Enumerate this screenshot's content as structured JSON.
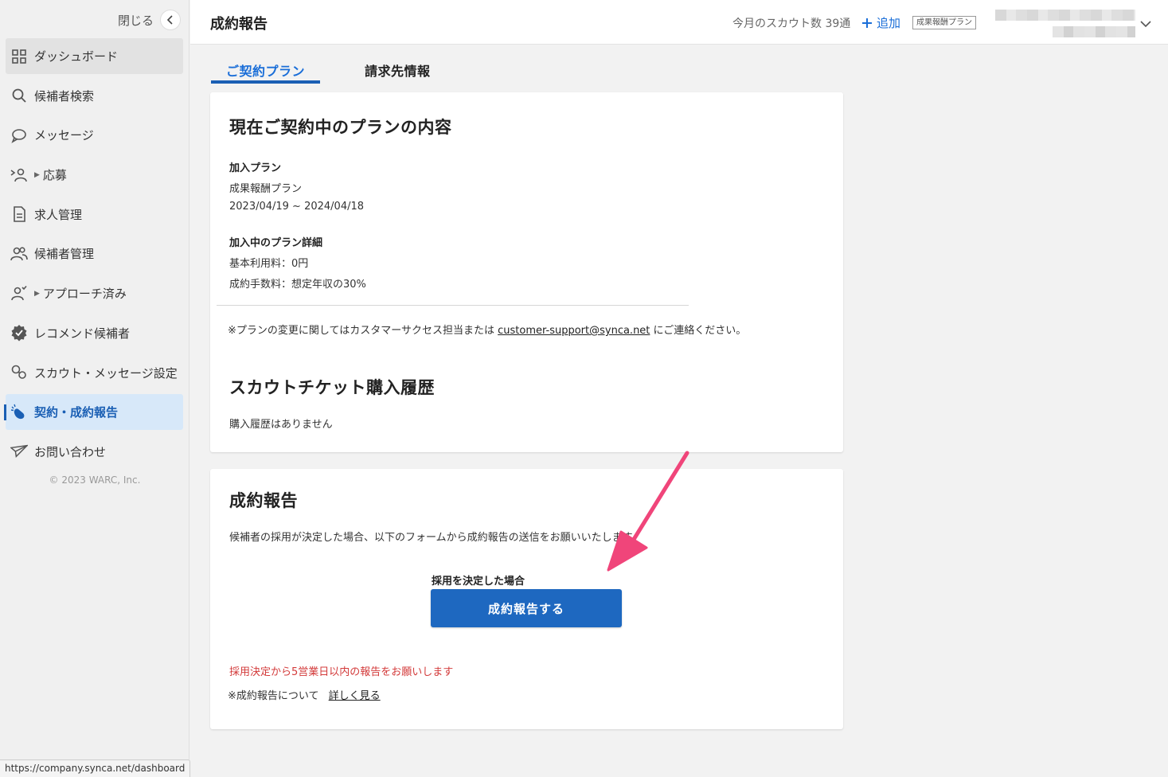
{
  "sidebar": {
    "close_label": "閉じる",
    "items": [
      {
        "label": "ダッシュボード"
      },
      {
        "label": "候補者検索"
      },
      {
        "label": "メッセージ"
      },
      {
        "label": "応募"
      },
      {
        "label": "求人管理"
      },
      {
        "label": "候補者管理"
      },
      {
        "label": "アプローチ済み"
      },
      {
        "label": "レコメンド候補者"
      },
      {
        "label": "スカウト・メッセージ設定"
      },
      {
        "label": "契約・成約報告"
      },
      {
        "label": "お問い合わせ"
      }
    ],
    "copyright": "© 2023 WARC, Inc."
  },
  "status_url": "https://company.synca.net/dashboard",
  "header": {
    "title": "成約報告",
    "scout_count": "今月のスカウト数 39通",
    "add_label": "追加",
    "plan_badge": "成果報酬プラン"
  },
  "tabs": [
    {
      "label": "ご契約プラン",
      "active": true
    },
    {
      "label": "請求先情報",
      "active": false
    }
  ],
  "contract": {
    "heading": "現在ご契約中のプランの内容",
    "plan_label": "加入プラン",
    "plan_name": "成果報酬プラン",
    "plan_period": "2023/04/19 ~ 2024/04/18",
    "detail_label": "加入中のプラン詳細",
    "base_fee": "基本利用料：0円",
    "success_fee": "成約手数料：想定年収の30%",
    "note_prefix": "※プランの変更に関してはカスタマーサクセス担当または",
    "note_email": "customer-support@synca.net",
    "note_suffix": "にご連絡ください。",
    "history_heading": "スカウトチケット購入履歴",
    "history_empty": "購入履歴はありません"
  },
  "report": {
    "heading": "成約報告",
    "description": "候補者の採用が決定した場合、以下のフォームから成約報告の送信をお願いいたします。",
    "decide_label": "採用を決定した場合",
    "button_label": "成約報告する",
    "warning": "採用決定から5営業日以内の報告をお願いします",
    "about_prefix": "※成約報告について",
    "about_link": "詳しく見る"
  },
  "colors": {
    "accent": "#1a6ed8",
    "button": "#1e68c0",
    "warning": "#d33a3a",
    "annotation_arrow": "#f0457a"
  }
}
